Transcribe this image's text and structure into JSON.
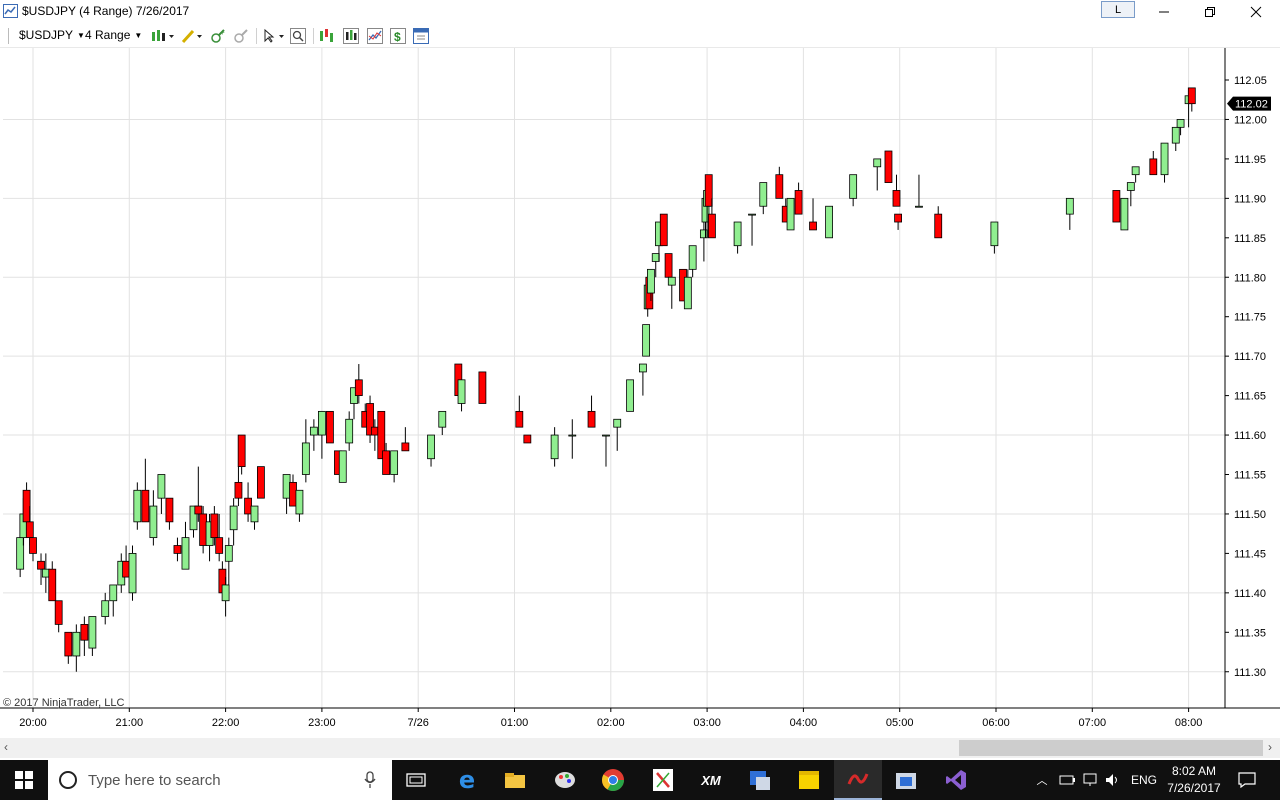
{
  "window": {
    "title": "$USDJPY (4 Range)  7/26/2017",
    "l_button": "L",
    "minimize_icon": "minimize-icon",
    "maximize_icon": "restore-icon",
    "close_icon": "close-icon"
  },
  "toolbar": {
    "instrument": "$USDJPY",
    "period": "4 Range",
    "icons": [
      "bar-type-icon",
      "drawing-tool-icon",
      "zoom-in-icon",
      "zoom-out-icon",
      "cursor-icon",
      "search-icon",
      "indicators-icon",
      "strategies-icon",
      "templates-icon",
      "chart-trader-icon",
      "properties-icon"
    ]
  },
  "chart": {
    "copyright": "© 2017 NinjaTrader, LLC",
    "current_price": "112.02",
    "up_color": "#90ee90",
    "down_color": "#ff0000",
    "price_tag_color": "#000000"
  },
  "chart_data": {
    "type": "candlestick",
    "instrument": "$USDJPY",
    "bar_type": "4 Range",
    "y_ticks": [
      "112.05",
      "112.00",
      "111.95",
      "111.90",
      "111.85",
      "111.80",
      "111.75",
      "111.70",
      "111.65",
      "111.60",
      "111.55",
      "111.50",
      "111.45",
      "111.40",
      "111.35",
      "111.30"
    ],
    "x_ticks": [
      "20:00",
      "21:00",
      "22:00",
      "23:00",
      "7/26",
      "01:00",
      "02:00",
      "03:00",
      "04:00",
      "05:00",
      "06:00",
      "07:00",
      "08:00"
    ],
    "ylim": [
      111.28,
      112.08
    ],
    "last_price": 112.02,
    "grid": true,
    "candles": [
      {
        "t": "19:52",
        "o": 111.43,
        "h": 111.5,
        "l": 111.42,
        "c": 111.47
      },
      {
        "t": "19:54",
        "o": 111.47,
        "h": 111.52,
        "l": 111.46,
        "c": 111.5
      },
      {
        "t": "19:56",
        "o": 111.53,
        "h": 111.54,
        "l": 111.49,
        "c": 111.49
      },
      {
        "t": "19:58",
        "o": 111.49,
        "h": 111.51,
        "l": 111.46,
        "c": 111.47
      },
      {
        "t": "20:00",
        "o": 111.47,
        "h": 111.47,
        "l": 111.44,
        "c": 111.45
      },
      {
        "t": "20:05",
        "o": 111.44,
        "h": 111.45,
        "l": 111.41,
        "c": 111.43
      },
      {
        "t": "20:08",
        "o": 111.42,
        "h": 111.45,
        "l": 111.4,
        "c": 111.43
      },
      {
        "t": "20:12",
        "o": 111.43,
        "h": 111.44,
        "l": 111.39,
        "c": 111.39
      },
      {
        "t": "20:16",
        "o": 111.39,
        "h": 111.39,
        "l": 111.35,
        "c": 111.36
      },
      {
        "t": "20:22",
        "o": 111.35,
        "h": 111.35,
        "l": 111.31,
        "c": 111.32
      },
      {
        "t": "20:27",
        "o": 111.32,
        "h": 111.36,
        "l": 111.3,
        "c": 111.35
      },
      {
        "t": "20:32",
        "o": 111.36,
        "h": 111.37,
        "l": 111.32,
        "c": 111.34
      },
      {
        "t": "20:37",
        "o": 111.33,
        "h": 111.37,
        "l": 111.32,
        "c": 111.37
      },
      {
        "t": "20:45",
        "o": 111.37,
        "h": 111.4,
        "l": 111.36,
        "c": 111.39
      },
      {
        "t": "20:50",
        "o": 111.39,
        "h": 111.41,
        "l": 111.37,
        "c": 111.41
      },
      {
        "t": "20:55",
        "o": 111.41,
        "h": 111.45,
        "l": 111.4,
        "c": 111.44
      },
      {
        "t": "20:58",
        "o": 111.44,
        "h": 111.46,
        "l": 111.42,
        "c": 111.42
      },
      {
        "t": "21:02",
        "o": 111.4,
        "h": 111.46,
        "l": 111.39,
        "c": 111.45
      },
      {
        "t": "21:05",
        "o": 111.49,
        "h": 111.54,
        "l": 111.48,
        "c": 111.53
      },
      {
        "t": "21:10",
        "o": 111.53,
        "h": 111.57,
        "l": 111.49,
        "c": 111.49
      },
      {
        "t": "21:15",
        "o": 111.47,
        "h": 111.53,
        "l": 111.46,
        "c": 111.51
      },
      {
        "t": "21:20",
        "o": 111.52,
        "h": 111.55,
        "l": 111.5,
        "c": 111.55
      },
      {
        "t": "21:25",
        "o": 111.52,
        "h": 111.52,
        "l": 111.48,
        "c": 111.49
      },
      {
        "t": "21:30",
        "o": 111.46,
        "h": 111.47,
        "l": 111.44,
        "c": 111.45
      },
      {
        "t": "21:35",
        "o": 111.43,
        "h": 111.49,
        "l": 111.43,
        "c": 111.47
      },
      {
        "t": "21:40",
        "o": 111.48,
        "h": 111.51,
        "l": 111.47,
        "c": 111.51
      },
      {
        "t": "21:43",
        "o": 111.51,
        "h": 111.56,
        "l": 111.49,
        "c": 111.5
      },
      {
        "t": "21:46",
        "o": 111.5,
        "h": 111.51,
        "l": 111.45,
        "c": 111.46
      },
      {
        "t": "21:50",
        "o": 111.46,
        "h": 111.5,
        "l": 111.44,
        "c": 111.49
      },
      {
        "t": "21:53",
        "o": 111.5,
        "h": 111.51,
        "l": 111.46,
        "c": 111.47
      },
      {
        "t": "21:56",
        "o": 111.47,
        "h": 111.5,
        "l": 111.44,
        "c": 111.45
      },
      {
        "t": "21:58",
        "o": 111.43,
        "h": 111.44,
        "l": 111.4,
        "c": 111.4
      },
      {
        "t": "22:00",
        "o": 111.39,
        "h": 111.42,
        "l": 111.37,
        "c": 111.41
      },
      {
        "t": "22:02",
        "o": 111.44,
        "h": 111.47,
        "l": 111.41,
        "c": 111.46
      },
      {
        "t": "22:05",
        "o": 111.48,
        "h": 111.52,
        "l": 111.46,
        "c": 111.51
      },
      {
        "t": "22:08",
        "o": 111.54,
        "h": 111.56,
        "l": 111.51,
        "c": 111.52
      },
      {
        "t": "22:10",
        "o": 111.6,
        "h": 111.6,
        "l": 111.55,
        "c": 111.56
      },
      {
        "t": "22:14",
        "o": 111.52,
        "h": 111.54,
        "l": 111.49,
        "c": 111.5
      },
      {
        "t": "22:18",
        "o": 111.49,
        "h": 111.51,
        "l": 111.48,
        "c": 111.51
      },
      {
        "t": "22:22",
        "o": 111.56,
        "h": 111.56,
        "l": 111.52,
        "c": 111.52
      },
      {
        "t": "22:38",
        "o": 111.52,
        "h": 111.55,
        "l": 111.5,
        "c": 111.55
      },
      {
        "t": "22:42",
        "o": 111.54,
        "h": 111.55,
        "l": 111.51,
        "c": 111.51
      },
      {
        "t": "22:46",
        "o": 111.5,
        "h": 111.53,
        "l": 111.49,
        "c": 111.53
      },
      {
        "t": "22:50",
        "o": 111.55,
        "h": 111.62,
        "l": 111.54,
        "c": 111.59
      },
      {
        "t": "22:55",
        "o": 111.6,
        "h": 111.62,
        "l": 111.58,
        "c": 111.61
      },
      {
        "t": "23:00",
        "o": 111.6,
        "h": 111.63,
        "l": 111.57,
        "c": 111.63
      },
      {
        "t": "23:05",
        "o": 111.63,
        "h": 111.63,
        "l": 111.59,
        "c": 111.59
      },
      {
        "t": "23:10",
        "o": 111.58,
        "h": 111.58,
        "l": 111.55,
        "c": 111.55
      },
      {
        "t": "23:13",
        "o": 111.54,
        "h": 111.58,
        "l": 111.54,
        "c": 111.58
      },
      {
        "t": "23:17",
        "o": 111.59,
        "h": 111.63,
        "l": 111.58,
        "c": 111.62
      },
      {
        "t": "23:20",
        "o": 111.64,
        "h": 111.66,
        "l": 111.62,
        "c": 111.66
      },
      {
        "t": "23:23",
        "o": 111.67,
        "h": 111.69,
        "l": 111.64,
        "c": 111.65
      },
      {
        "t": "23:27",
        "o": 111.63,
        "h": 111.64,
        "l": 111.61,
        "c": 111.61
      },
      {
        "t": "23:30",
        "o": 111.64,
        "h": 111.65,
        "l": 111.59,
        "c": 111.6
      },
      {
        "t": "23:33",
        "o": 111.61,
        "h": 111.62,
        "l": 111.58,
        "c": 111.6
      },
      {
        "t": "23:37",
        "o": 111.63,
        "h": 111.63,
        "l": 111.57,
        "c": 111.57
      },
      {
        "t": "23:40",
        "o": 111.58,
        "h": 111.59,
        "l": 111.55,
        "c": 111.55
      },
      {
        "t": "23:45",
        "o": 111.55,
        "h": 111.58,
        "l": 111.54,
        "c": 111.58
      },
      {
        "t": "23:52",
        "o": 111.59,
        "h": 111.61,
        "l": 111.58,
        "c": 111.58
      },
      {
        "t": "00:08",
        "o": 111.57,
        "h": 111.6,
        "l": 111.56,
        "c": 111.6
      },
      {
        "t": "00:15",
        "o": 111.61,
        "h": 111.63,
        "l": 111.6,
        "c": 111.63
      },
      {
        "t": "00:25",
        "o": 111.69,
        "h": 111.69,
        "l": 111.65,
        "c": 111.65
      },
      {
        "t": "00:27",
        "o": 111.64,
        "h": 111.67,
        "l": 111.63,
        "c": 111.67
      },
      {
        "t": "00:40",
        "o": 111.68,
        "h": 111.68,
        "l": 111.64,
        "c": 111.64
      },
      {
        "t": "01:03",
        "o": 111.63,
        "h": 111.65,
        "l": 111.61,
        "c": 111.61
      },
      {
        "t": "01:08",
        "o": 111.6,
        "h": 111.6,
        "l": 111.59,
        "c": 111.59
      },
      {
        "t": "01:25",
        "o": 111.57,
        "h": 111.61,
        "l": 111.56,
        "c": 111.6
      },
      {
        "t": "01:36",
        "o": 111.6,
        "h": 111.62,
        "l": 111.57,
        "c": 111.6
      },
      {
        "t": "01:48",
        "o": 111.63,
        "h": 111.65,
        "l": 111.61,
        "c": 111.61
      },
      {
        "t": "01:57",
        "o": 111.6,
        "h": 111.6,
        "l": 111.56,
        "c": 111.6
      },
      {
        "t": "02:04",
        "o": 111.61,
        "h": 111.62,
        "l": 111.58,
        "c": 111.62
      },
      {
        "t": "02:12",
        "o": 111.63,
        "h": 111.67,
        "l": 111.63,
        "c": 111.67
      },
      {
        "t": "02:20",
        "o": 111.68,
        "h": 111.69,
        "l": 111.65,
        "c": 111.69
      },
      {
        "t": "02:22",
        "o": 111.7,
        "h": 111.74,
        "l": 111.7,
        "c": 111.74
      },
      {
        "t": "02:23",
        "o": 111.76,
        "h": 111.79,
        "l": 111.75,
        "c": 111.79
      },
      {
        "t": "02:24",
        "o": 111.8,
        "h": 111.81,
        "l": 111.76,
        "c": 111.76
      },
      {
        "t": "02:25",
        "o": 111.78,
        "h": 111.81,
        "l": 111.77,
        "c": 111.81
      },
      {
        "t": "02:28",
        "o": 111.82,
        "h": 111.83,
        "l": 111.8,
        "c": 111.83
      },
      {
        "t": "02:30",
        "o": 111.84,
        "h": 111.87,
        "l": 111.82,
        "c": 111.87
      },
      {
        "t": "02:33",
        "o": 111.88,
        "h": 111.88,
        "l": 111.84,
        "c": 111.84
      },
      {
        "t": "02:36",
        "o": 111.83,
        "h": 111.83,
        "l": 111.8,
        "c": 111.8
      },
      {
        "t": "02:38",
        "o": 111.79,
        "h": 111.8,
        "l": 111.76,
        "c": 111.8
      },
      {
        "t": "02:45",
        "o": 111.81,
        "h": 111.81,
        "l": 111.77,
        "c": 111.77
      },
      {
        "t": "02:48",
        "o": 111.76,
        "h": 111.81,
        "l": 111.76,
        "c": 111.8
      },
      {
        "t": "02:51",
        "o": 111.81,
        "h": 111.84,
        "l": 111.8,
        "c": 111.84
      },
      {
        "t": "02:58",
        "o": 111.85,
        "h": 111.87,
        "l": 111.82,
        "c": 111.86
      },
      {
        "t": "02:59",
        "o": 111.87,
        "h": 111.91,
        "l": 111.85,
        "c": 111.9
      },
      {
        "t": "03:00",
        "o": 111.89,
        "h": 111.92,
        "l": 111.85,
        "c": 111.91
      },
      {
        "t": "03:01",
        "o": 111.93,
        "h": 111.93,
        "l": 111.89,
        "c": 111.89
      },
      {
        "t": "03:03",
        "o": 111.88,
        "h": 111.9,
        "l": 111.85,
        "c": 111.85
      },
      {
        "t": "03:19",
        "o": 111.84,
        "h": 111.87,
        "l": 111.83,
        "c": 111.87
      },
      {
        "t": "03:28",
        "o": 111.88,
        "h": 111.88,
        "l": 111.84,
        "c": 111.88
      },
      {
        "t": "03:35",
        "o": 111.89,
        "h": 111.92,
        "l": 111.88,
        "c": 111.92
      },
      {
        "t": "03:45",
        "o": 111.93,
        "h": 111.94,
        "l": 111.9,
        "c": 111.9
      },
      {
        "t": "03:49",
        "o": 111.89,
        "h": 111.9,
        "l": 111.87,
        "c": 111.87
      },
      {
        "t": "03:52",
        "o": 111.86,
        "h": 111.9,
        "l": 111.86,
        "c": 111.9
      },
      {
        "t": "03:57",
        "o": 111.91,
        "h": 111.92,
        "l": 111.88,
        "c": 111.88
      },
      {
        "t": "04:06",
        "o": 111.87,
        "h": 111.9,
        "l": 111.86,
        "c": 111.86
      },
      {
        "t": "04:16",
        "o": 111.85,
        "h": 111.89,
        "l": 111.85,
        "c": 111.89
      },
      {
        "t": "04:31",
        "o": 111.9,
        "h": 111.93,
        "l": 111.89,
        "c": 111.93
      },
      {
        "t": "04:46",
        "o": 111.94,
        "h": 111.95,
        "l": 111.91,
        "c": 111.95
      },
      {
        "t": "04:53",
        "o": 111.96,
        "h": 111.96,
        "l": 111.92,
        "c": 111.92
      },
      {
        "t": "04:58",
        "o": 111.91,
        "h": 111.93,
        "l": 111.89,
        "c": 111.89
      },
      {
        "t": "04:59",
        "o": 111.88,
        "h": 111.88,
        "l": 111.86,
        "c": 111.87
      },
      {
        "t": "05:12",
        "o": 111.89,
        "h": 111.93,
        "l": 111.89,
        "c": 111.89
      },
      {
        "t": "05:24",
        "o": 111.88,
        "h": 111.89,
        "l": 111.85,
        "c": 111.85
      },
      {
        "t": "05:59",
        "o": 111.84,
        "h": 111.87,
        "l": 111.83,
        "c": 111.87
      },
      {
        "t": "06:46",
        "o": 111.88,
        "h": 111.9,
        "l": 111.86,
        "c": 111.9
      },
      {
        "t": "07:15",
        "o": 111.91,
        "h": 111.91,
        "l": 111.87,
        "c": 111.87
      },
      {
        "t": "07:20",
        "o": 111.86,
        "h": 111.9,
        "l": 111.86,
        "c": 111.9
      },
      {
        "t": "07:24",
        "o": 111.91,
        "h": 111.92,
        "l": 111.89,
        "c": 111.92
      },
      {
        "t": "07:27",
        "o": 111.93,
        "h": 111.94,
        "l": 111.92,
        "c": 111.94
      },
      {
        "t": "07:38",
        "o": 111.95,
        "h": 111.96,
        "l": 111.93,
        "c": 111.93
      },
      {
        "t": "07:45",
        "o": 111.93,
        "h": 111.97,
        "l": 111.92,
        "c": 111.97
      },
      {
        "t": "07:52",
        "o": 111.97,
        "h": 111.99,
        "l": 111.96,
        "c": 111.99
      },
      {
        "t": "07:55",
        "o": 111.99,
        "h": 112.0,
        "l": 111.98,
        "c": 112.0
      },
      {
        "t": "08:00",
        "o": 112.02,
        "h": 112.03,
        "l": 111.99,
        "c": 112.03
      },
      {
        "t": "08:02",
        "o": 112.04,
        "h": 112.04,
        "l": 112.01,
        "c": 112.02
      }
    ]
  },
  "scrollbar": {
    "left_arrow": "‹",
    "right_arrow": "›"
  },
  "taskbar": {
    "search_placeholder": "Type here to search",
    "language": "ENG",
    "time": "8:02 AM",
    "date": "7/26/2017",
    "apps": [
      "task-view-icon",
      "edge-icon",
      "file-explorer-icon",
      "paint-icon",
      "chrome-icon",
      "x-app-icon",
      "xm-icon",
      "app-icon",
      "sticky-notes-icon",
      "ninjatrader-icon",
      "store-icon",
      "visual-studio-icon"
    ]
  }
}
